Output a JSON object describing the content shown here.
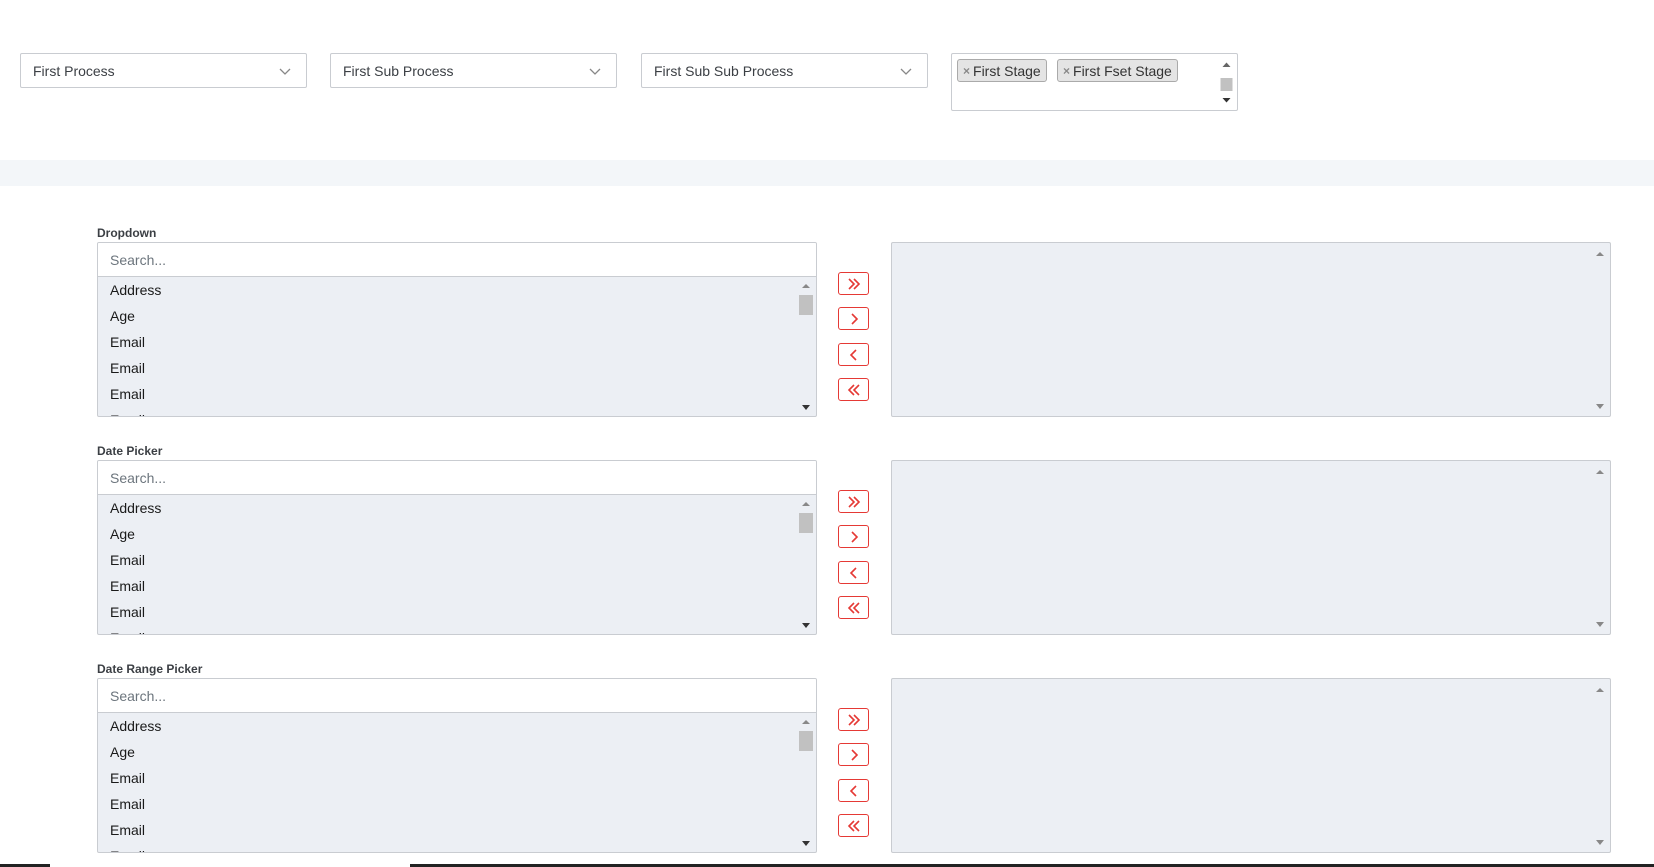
{
  "filters": {
    "process": "First Process",
    "sub_process": "First Sub Process",
    "sub_sub_process": "First Sub Sub Process",
    "stages": [
      "First Stage",
      "First Fset Stage"
    ]
  },
  "colors": {
    "accent": "#e53935",
    "list_bg": "#eceff4",
    "band": "#f3f6f9"
  },
  "sections": [
    {
      "label": "Dropdown",
      "search_placeholder": "Search...",
      "options": [
        "Address",
        "Age",
        "Email",
        "Email",
        "Email",
        "Email"
      ]
    },
    {
      "label": "Date Picker",
      "search_placeholder": "Search...",
      "options": [
        "Address",
        "Age",
        "Email",
        "Email",
        "Email",
        "Email"
      ]
    },
    {
      "label": "Date Range Picker",
      "search_placeholder": "Search...",
      "options": [
        "Address",
        "Age",
        "Email",
        "Email",
        "Email",
        "Email"
      ]
    }
  ],
  "transfer_buttons": [
    "move-all-right-icon",
    "move-right-icon",
    "move-left-icon",
    "move-all-left-icon"
  ]
}
